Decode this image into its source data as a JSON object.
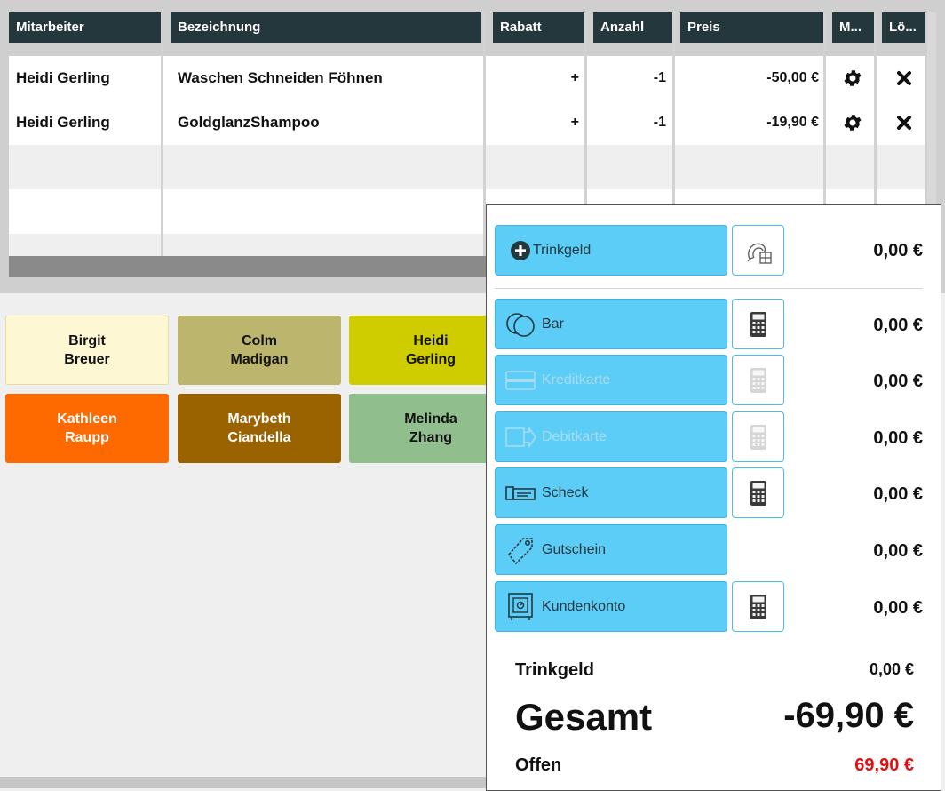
{
  "table": {
    "headers": [
      "Mitarbeiter",
      "Bezeichnung",
      "Rabatt",
      "Anzahl",
      "Preis",
      "M...",
      "Lö..."
    ],
    "rows": [
      {
        "mitarbeiter": "Heidi Gerling",
        "bezeichnung": "Waschen Schneiden Föhnen",
        "rabatt": "+",
        "anzahl": "-1",
        "preis": "-50,00 €"
      },
      {
        "mitarbeiter": "Heidi Gerling",
        "bezeichnung": "GoldglanzShampoo",
        "rabatt": "+",
        "anzahl": "-1",
        "preis": "-19,90 €"
      }
    ],
    "row_icons": [
      "gear-icon",
      "close-icon"
    ]
  },
  "employees": [
    {
      "first": "Birgit",
      "last": "Breuer",
      "bg": "#fdf7d3",
      "fg": "#111111"
    },
    {
      "first": "Colm",
      "last": "Madigan",
      "bg": "#bcb56d",
      "fg": "#111111"
    },
    {
      "first": "Heidi",
      "last": "Gerling",
      "bg": "#cfcc00",
      "fg": "#111111"
    },
    {
      "first": "Kathleen",
      "last": "Raupp",
      "bg": "#ff6a00",
      "fg": "#ffffff"
    },
    {
      "first": "Marybeth",
      "last": "Ciandella",
      "bg": "#9a6300",
      "fg": "#ffffff"
    },
    {
      "first": "Melinda",
      "last": "Zhang",
      "bg": "#90be8c",
      "fg": "#111111"
    }
  ],
  "payment": {
    "tip_button": {
      "label": "Trinkgeld",
      "amount": "0,00 €"
    },
    "methods": [
      {
        "label": "Bar",
        "amount": "0,00 €",
        "enabled": true,
        "icon": "coins-icon",
        "calc": true
      },
      {
        "label": "Kreditkarte",
        "amount": "0,00 €",
        "enabled": false,
        "icon": "credit-card-icon",
        "calc": true
      },
      {
        "label": "Debitkarte",
        "amount": "0,00 €",
        "enabled": false,
        "icon": "debit-card-icon",
        "calc": true
      },
      {
        "label": "Scheck",
        "amount": "0,00 €",
        "enabled": true,
        "icon": "cheque-icon",
        "calc": true
      },
      {
        "label": "Gutschein",
        "amount": "0,00 €",
        "enabled": true,
        "icon": "voucher-tag-icon",
        "calc": false
      },
      {
        "label": "Kundenkonto",
        "amount": "0,00 €",
        "enabled": true,
        "icon": "safe-icon",
        "calc": true
      }
    ],
    "summary": {
      "trinkgeld_label": "Trinkgeld",
      "trinkgeld_value": "0,00 €",
      "gesamt_label": "Gesamt",
      "gesamt_value": "-69,90 €",
      "offen_label": "Offen",
      "offen_value": "69,90 €"
    }
  },
  "colors": {
    "header_bg": "#24373d",
    "button_blue": "#5bcdf7",
    "open_red": "#e01010"
  }
}
